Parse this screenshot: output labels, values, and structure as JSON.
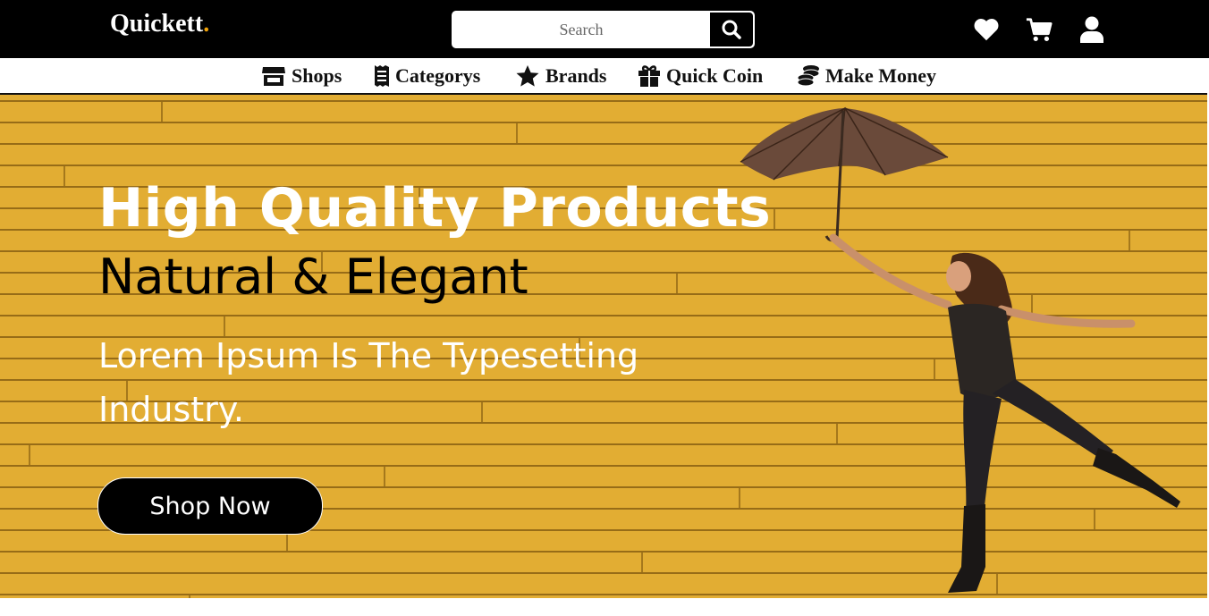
{
  "header": {
    "logo": {
      "text": "Quickett",
      "dot": "."
    },
    "search": {
      "placeholder": "Search",
      "button_icon": "search-icon"
    },
    "icons": [
      "heart-icon",
      "cart-icon",
      "user-icon"
    ]
  },
  "nav": {
    "items": [
      {
        "label": "Shops",
        "icon": "store-icon"
      },
      {
        "label": "Categorys",
        "icon": "receipt-icon"
      },
      {
        "label": "Brands",
        "icon": "star-icon"
      },
      {
        "label": "Quick Coin",
        "icon": "gift-icon"
      },
      {
        "label": "Make Money",
        "icon": "coins-icon"
      }
    ]
  },
  "hero": {
    "title": "High Quality Products",
    "subtitle": "Natural & Elegant",
    "description": "Lorem Ipsum Is The Typesetting Industry.",
    "cta_label": "Shop Now",
    "image": "woman-with-umbrella-photo"
  },
  "colors": {
    "header_bg": "#000000",
    "logo_dot": "#f0a30a",
    "hero_bg": "#e2ad33",
    "cta_bg": "#000000"
  }
}
